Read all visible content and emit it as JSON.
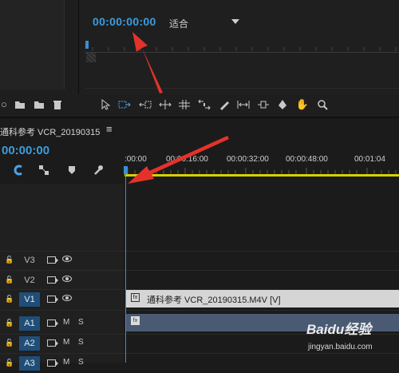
{
  "monitor": {
    "timecode": "00:00:00:00",
    "fit_label": "适合"
  },
  "project_toolbar": {
    "icons": [
      "search-icon",
      "folder-icon",
      "folder-icon",
      "trash-icon"
    ]
  },
  "tools": [
    "selection-tool-icon",
    "track-select-tool-icon",
    "ripple-edit-tool-icon",
    "rolling-edit-tool-icon",
    "rate-stretch-tool-icon",
    "razor-tool-icon",
    "slip-tool-icon",
    "slide-tool-icon",
    "pen-tool-icon",
    "hand-tool-icon",
    "zoom-tool-icon"
  ],
  "sequence": {
    "title": "通科参考 VCR_20190315",
    "menu_symbol": "≡",
    "timecode": "00:00:00",
    "ruler_ticks": [
      ":00:00",
      "00:00:16:00",
      "00:00:32:00",
      "00:00:48:00",
      "00:01:04"
    ]
  },
  "tracks": [
    {
      "name": "V3",
      "type": "video",
      "targeted": false
    },
    {
      "name": "V2",
      "type": "video",
      "targeted": false
    },
    {
      "name": "V1",
      "type": "video",
      "targeted": true
    },
    {
      "name": "A1",
      "type": "audio",
      "targeted": true,
      "mute": "M",
      "solo": "S"
    },
    {
      "name": "A2",
      "type": "audio",
      "targeted": true,
      "mute": "M",
      "solo": "S"
    },
    {
      "name": "A3",
      "type": "audio",
      "targeted": true,
      "mute": "M",
      "solo": "S"
    }
  ],
  "clips": {
    "video_label": "通科参考 VCR_20190315.M4V [V]",
    "fx_badge": "fx"
  },
  "watermark": {
    "brand": "Baidu经验",
    "url": "jingyan.baidu.com"
  },
  "colors": {
    "accent_blue": "#3a9de0",
    "ruler_yellow": "#d6d000",
    "annotation_red": "#e4322b"
  }
}
